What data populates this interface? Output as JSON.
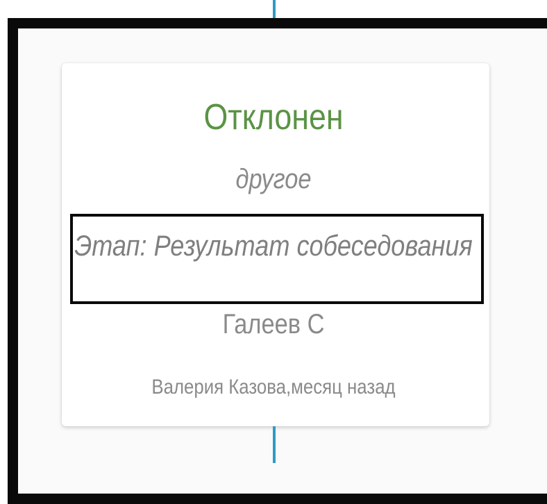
{
  "event": {
    "status": "Отклонен",
    "reason": "другое",
    "stage": "Этап: Результат собеседования",
    "candidate": "Галеев С",
    "author_time": "Валерия Казова,месяц назад"
  },
  "colors": {
    "status": "#5a9344",
    "timeline": "#2e9bc6",
    "frame": "#0a0a0a",
    "muted_text": "#8a8a8a"
  }
}
